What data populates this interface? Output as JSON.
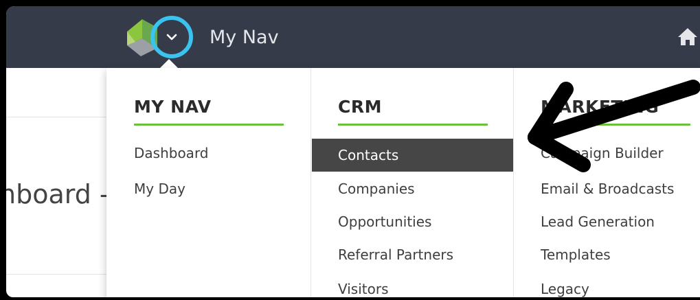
{
  "topbar": {
    "title": "My Nav"
  },
  "page": {
    "title": "hboard -"
  },
  "menu": {
    "columns": [
      {
        "heading": "MY NAV",
        "items": [
          "Dashboard",
          "My Day"
        ]
      },
      {
        "heading": "CRM",
        "items": [
          "Contacts",
          "Companies",
          "Opportunities",
          "Referral Partners",
          "Visitors"
        ],
        "active_item": "Contacts"
      },
      {
        "heading": "MARKETING",
        "items": [
          "Campaign Builder",
          "Email & Broadcasts",
          "Lead Generation",
          "Templates",
          "Legacy"
        ]
      }
    ]
  },
  "colors": {
    "topbar": "#353b48",
    "highlight_ring": "#3bc2ef",
    "accent_rule": "#6abf3f",
    "active_item_bg": "#464646"
  },
  "icons": [
    "logo-icon",
    "chevron-down-icon",
    "home-icon"
  ]
}
